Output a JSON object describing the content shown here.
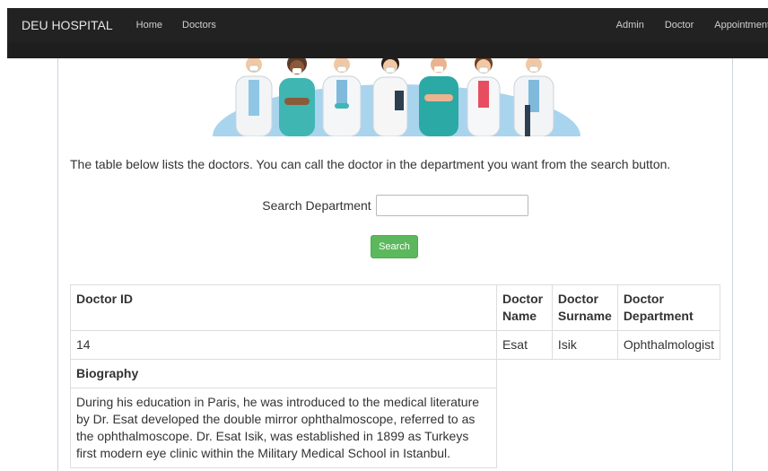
{
  "navbar": {
    "brand": "DEU HOSPITAL",
    "left_links": [
      "Home",
      "Doctors"
    ],
    "right_links": [
      "Admin",
      "Doctor",
      "Appointment"
    ]
  },
  "intro_text": "The table below lists the doctors. You can call the doctor in the department you want from the search button.",
  "search": {
    "label": "Search Department",
    "value": "",
    "button_label": "Search"
  },
  "table": {
    "headers": {
      "id": "Doctor ID",
      "name_line1": "Doctor",
      "name_line2": "Name",
      "surname_line1": "Doctor",
      "surname_line2": "Surname",
      "dept_line1": "Doctor",
      "dept_line2": "Department"
    },
    "row": {
      "id": "14",
      "name": "Esat",
      "surname": "Isik",
      "department": "Ophthalmologist"
    },
    "biography_heading": "Biography",
    "biography_text": "During his education in Paris, he was introduced to the medical literature by Dr. Esat developed the double mirror ophthalmoscope, referred to as the ophthalmoscope. Dr. Esat Isik, was established in 1899 as Turkeys first modern eye clinic within the Military Medical School in Istanbul."
  },
  "colors": {
    "navbar": "#222222",
    "button_green": "#5cb85c",
    "scrub_teal": "#3fb6b2",
    "hero_bg": "#a9d4ee"
  }
}
